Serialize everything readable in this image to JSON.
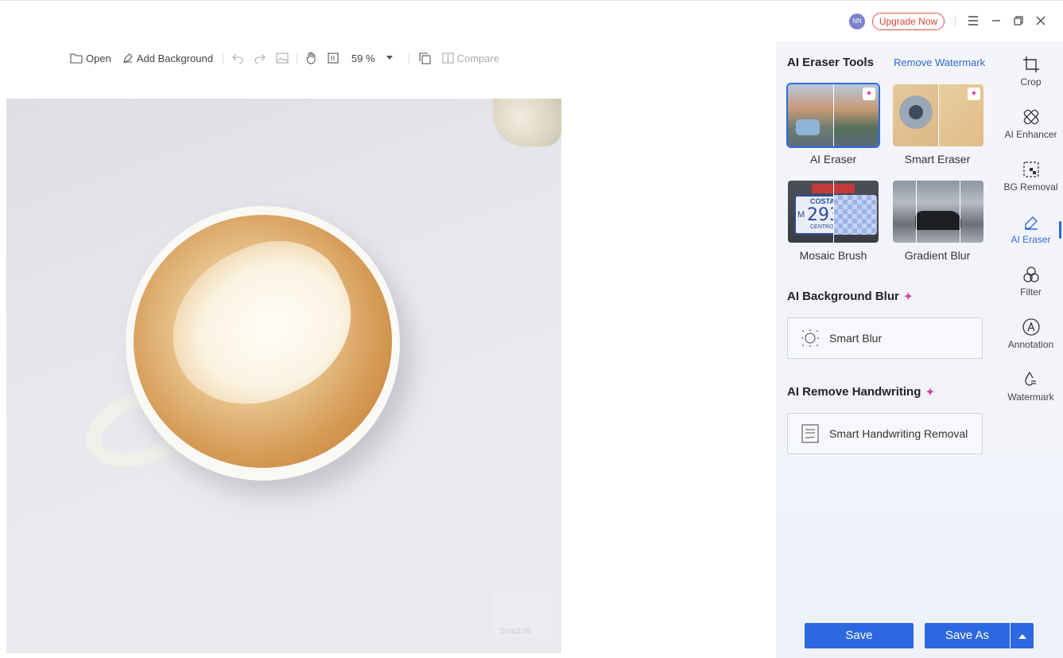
{
  "header": {
    "avatar_initials": "NN",
    "upgrade_label": "Upgrade Now",
    "icons": [
      "menu-icon",
      "minimize-icon",
      "restore-icon",
      "close-icon"
    ]
  },
  "toolbar": {
    "open_label": "Open",
    "add_background_label": "Add Background",
    "zoom_value": "59 %",
    "compare_label": "Compare",
    "icons": [
      "folder-icon",
      "background-icon",
      "undo-icon",
      "redo-icon",
      "image-icon",
      "hand-icon",
      "fit-icon",
      "zoom-dropdown-icon",
      "copy-icon",
      "compare-icon"
    ]
  },
  "canvas": {
    "watermark_text": "SnapEdit"
  },
  "panel": {
    "eraser_section_title": "AI Eraser Tools",
    "remove_watermark_link": "Remove Watermark",
    "tools": [
      {
        "label": "AI Eraser",
        "selected": true
      },
      {
        "label": "Smart Eraser",
        "selected": false
      },
      {
        "label": "Mosaic Brush",
        "selected": false
      },
      {
        "label": "Gradient Blur",
        "selected": false
      }
    ],
    "mosaic_plate_text": "COSTA",
    "mosaic_plate_number": "293",
    "mosaic_plate_sub": "CENTRO",
    "mosaic_plate_prefix": "M",
    "blur_section_title": "AI Background Blur",
    "smart_blur_label": "Smart Blur",
    "handwriting_section_title": "AI Remove Handwriting",
    "smart_handwriting_label": "Smart Handwriting Removal",
    "sparkle": "✦"
  },
  "rail": {
    "items": [
      {
        "label": "Crop",
        "icon": "crop-icon",
        "active": false
      },
      {
        "label": "AI Enhancer",
        "icon": "enhancer-icon",
        "active": false
      },
      {
        "label": "BG Removal",
        "icon": "bg-removal-icon",
        "active": false
      },
      {
        "label": "AI Eraser",
        "icon": "eraser-icon",
        "active": true
      },
      {
        "label": "Filter",
        "icon": "filter-icon",
        "active": false
      },
      {
        "label": "Annotation",
        "icon": "annotation-icon",
        "active": false
      },
      {
        "label": "Watermark",
        "icon": "watermark-icon",
        "active": false
      }
    ]
  },
  "footer": {
    "save_label": "Save",
    "save_as_label": "Save As"
  },
  "colors": {
    "accent": "#2d68e0",
    "upgrade": "#d8453c",
    "sparkle": "#d0429d"
  }
}
